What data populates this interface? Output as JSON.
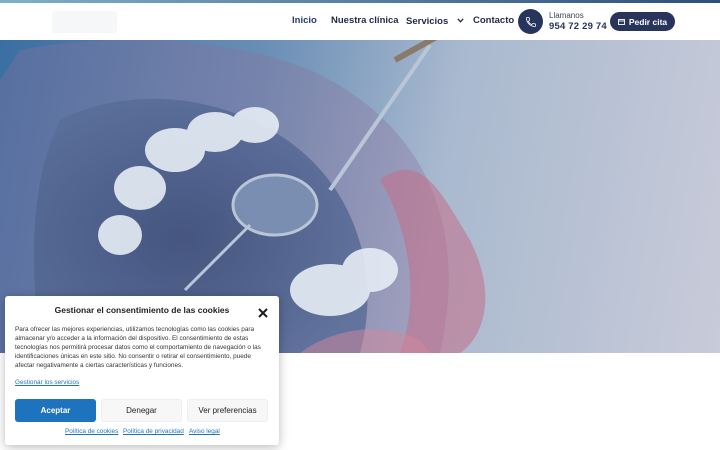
{
  "nav": {
    "items": [
      {
        "label": "Inicio",
        "active": true
      },
      {
        "label": "Nuestra clínica"
      },
      {
        "label": "Servicios",
        "has_dropdown": true
      },
      {
        "label": "Contacto"
      }
    ]
  },
  "call": {
    "label": "Llamanos",
    "number": "954 72 29 74",
    "icon": "phone-icon"
  },
  "cta": {
    "label": "Pedir cita",
    "icon": "calendar-icon"
  },
  "colors": {
    "brand_dark": "#27345c",
    "accent_blue": "#1e73be"
  },
  "cookie_banner": {
    "title": "Gestionar el consentimiento de las cookies",
    "text": "Para ofrecer las mejores experiencias, utilizamos tecnologías como las cookies para almacenar y/o acceder a la información del dispositivo. El consentimiento de estas tecnologías nos permitirá procesar datos como el comportamiento de navegación o las identificaciones únicas en este sitio. No consentir o retirar el consentimiento, puede afectar negativamente a ciertas características y funciones.",
    "manage_link": "Gestionar los servicios",
    "accept_label": "Aceptar",
    "deny_label": "Denegar",
    "prefs_label": "Ver preferencias",
    "links": [
      "Política de cookies",
      "Política de privacidad",
      "Aviso legal"
    ]
  }
}
